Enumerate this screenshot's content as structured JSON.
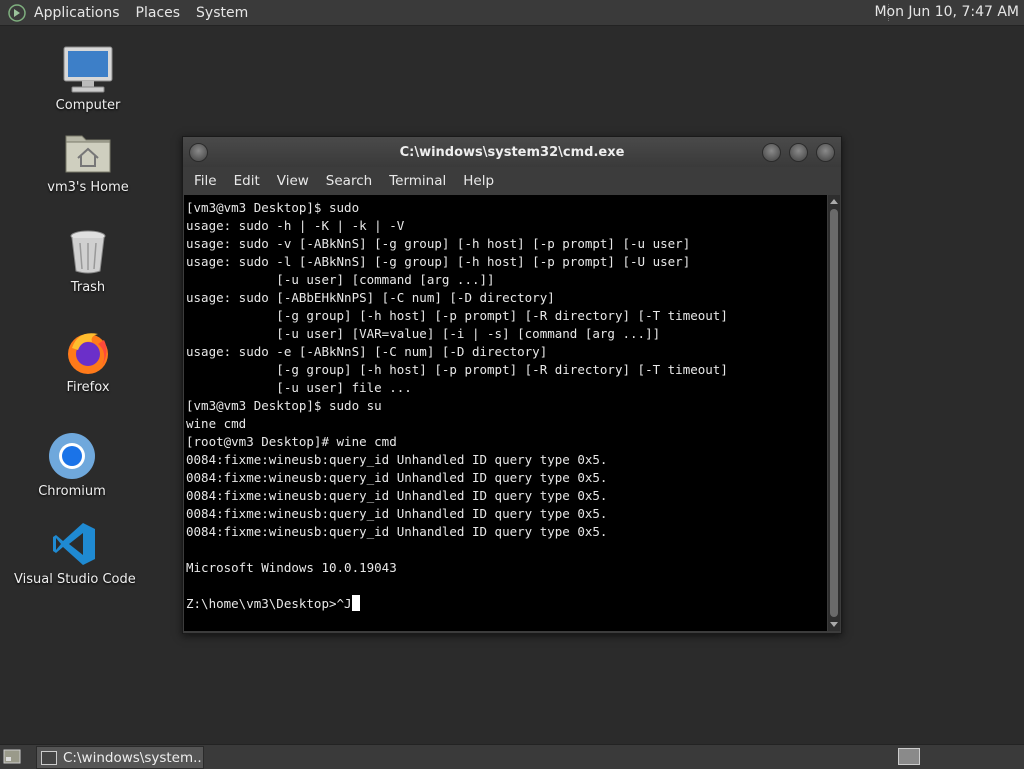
{
  "top_panel": {
    "menus": [
      "Applications",
      "Places",
      "System"
    ],
    "clock": "Mon Jun 10,  7:47 AM"
  },
  "desktop_icons": [
    {
      "label": "Computer",
      "icon": "computer-icon"
    },
    {
      "label": "vm3's Home",
      "icon": "home-folder-icon"
    },
    {
      "label": "Trash",
      "icon": "trash-icon"
    },
    {
      "label": "Firefox",
      "icon": "firefox-icon"
    },
    {
      "label": "Chromium",
      "icon": "chromium-icon"
    },
    {
      "label": "Visual Studio Code",
      "icon": "vscode-icon"
    }
  ],
  "terminal": {
    "title": "C:\\windows\\system32\\cmd.exe",
    "menus": [
      "File",
      "Edit",
      "View",
      "Search",
      "Terminal",
      "Help"
    ],
    "lines": [
      "[vm3@vm3 Desktop]$ sudo",
      "usage: sudo -h | -K | -k | -V",
      "usage: sudo -v [-ABkNnS] [-g group] [-h host] [-p prompt] [-u user]",
      "usage: sudo -l [-ABkNnS] [-g group] [-h host] [-p prompt] [-U user]",
      "            [-u user] [command [arg ...]]",
      "usage: sudo [-ABbEHkNnPS] [-C num] [-D directory]",
      "            [-g group] [-h host] [-p prompt] [-R directory] [-T timeout]",
      "            [-u user] [VAR=value] [-i | -s] [command [arg ...]]",
      "usage: sudo -e [-ABkNnS] [-C num] [-D directory]",
      "            [-g group] [-h host] [-p prompt] [-R directory] [-T timeout]",
      "            [-u user] file ...",
      "[vm3@vm3 Desktop]$ sudo su",
      "wine cmd",
      "[root@vm3 Desktop]# wine cmd",
      "0084:fixme:wineusb:query_id Unhandled ID query type 0x5.",
      "0084:fixme:wineusb:query_id Unhandled ID query type 0x5.",
      "0084:fixme:wineusb:query_id Unhandled ID query type 0x5.",
      "0084:fixme:wineusb:query_id Unhandled ID query type 0x5.",
      "0084:fixme:wineusb:query_id Unhandled ID query type 0x5.",
      "",
      "Microsoft Windows 10.0.19043",
      ""
    ],
    "prompt": "Z:\\home\\vm3\\Desktop>^J"
  },
  "taskbar": {
    "task_label": "C:\\windows\\system..."
  },
  "colors": {
    "desktop_bg": "#2b2b2b",
    "panel_bg": "#3a3a3a",
    "terminal_bg": "#000000",
    "terminal_fg": "#e8e8e8"
  }
}
